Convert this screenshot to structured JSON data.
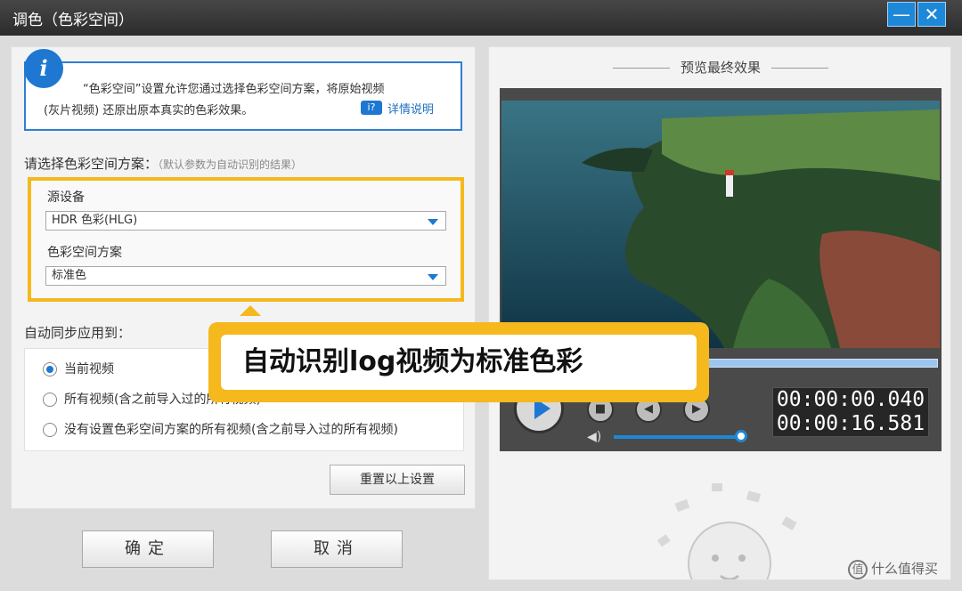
{
  "window": {
    "title": "调色（色彩空间）",
    "minimize_label": "—",
    "close_label": "✕"
  },
  "info": {
    "line1": "“色彩空间”设置允许您通过选择色彩空间方案，将原始视频",
    "line2": "(灰片视频) 还原出原本真实的色彩效果。",
    "help_icon_glyph": "i?",
    "help_link": "详情说明"
  },
  "scheme": {
    "label": "请选择色彩空间方案：",
    "hint": "（默认参数为自动识别的结果）",
    "source_device_label": "源设备",
    "source_device_value": "HDR 色彩(HLG)",
    "color_space_label": "色彩空间方案",
    "color_space_value": "标准色"
  },
  "sync": {
    "label": "自动同步应用到：",
    "options": [
      {
        "label": "当前视频",
        "selected": true
      },
      {
        "label": "所有视频(含之前导入过的所有视频)",
        "selected": false
      },
      {
        "label": "没有设置色彩空间方案的所有视频(含之前导入过的所有视频)",
        "selected": false
      }
    ]
  },
  "reset_label": "重置以上设置",
  "ok_label": "确定",
  "cancel_label": "取消",
  "preview": {
    "title": "预览最终效果",
    "time_current": "00:00:00.040",
    "time_total": "00:00:16.581",
    "volume_fraction": 0.97
  },
  "callout_text": "自动识别log视频为标准色彩",
  "watermark": {
    "logo": "值",
    "text": "什么值得买"
  },
  "colors": {
    "accent": "#1e78d2",
    "highlight": "#f5b81d"
  }
}
